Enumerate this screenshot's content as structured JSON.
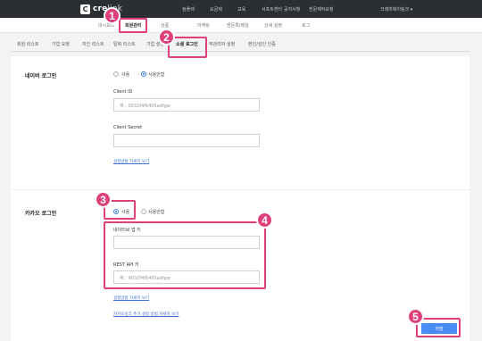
{
  "brand": {
    "logo_letter": "C",
    "name_bold": "cre",
    "name_thin": "link"
  },
  "topnav": [
    "컴플렉",
    "요금제",
    "교육",
    "서포트센터",
    "공지사항",
    "전문제작요청"
  ],
  "account": "크레마에이팅크 ▾",
  "subnav": [
    "대시보드",
    "회원관리",
    "상품",
    "마케팅",
    "방문록/메일",
    "상세 설정",
    "로그"
  ],
  "subnav_active": "회원관리",
  "tabs": [
    "회원 리스트",
    "기업 요청",
    "지인 리스트",
    "탈퇴 리스트",
    "기업 설정",
    "소셜 로그인",
    "부관리자 설정",
    "본인/성인 인증"
  ],
  "tabs_active": "소셜 로그인",
  "naver": {
    "title": "네이버 로그인",
    "radio_use": "사용",
    "radio_nouse": "사용안함",
    "selected": "사용안함",
    "client_id_label": "Client ID",
    "client_id_placeholder": "예 : 9032f4f6405adfgw",
    "client_secret_label": "Client Secret",
    "client_secret_value": "",
    "help_link": "설정방법 자세히 보기"
  },
  "kakao": {
    "title": "카카오 로그인",
    "radio_use": "사용",
    "radio_nouse": "사용안함",
    "selected": "사용",
    "native_key_label": "네이티브 앱 키",
    "native_key_value": "",
    "rest_key_label": "REST API 키",
    "rest_key_placeholder": "예 : 9032f4f6405adfgw",
    "help_link": "설정방법 자세히 보기",
    "extra_link": "카카오싱크 추가 설정 방법 자세히 보기"
  },
  "save_label": "저장",
  "callouts": [
    "1",
    "2",
    "3",
    "4",
    "5"
  ],
  "colors": {
    "accent": "#e0407a",
    "primary": "#4a8af4",
    "topbar": "#2b2e33"
  }
}
